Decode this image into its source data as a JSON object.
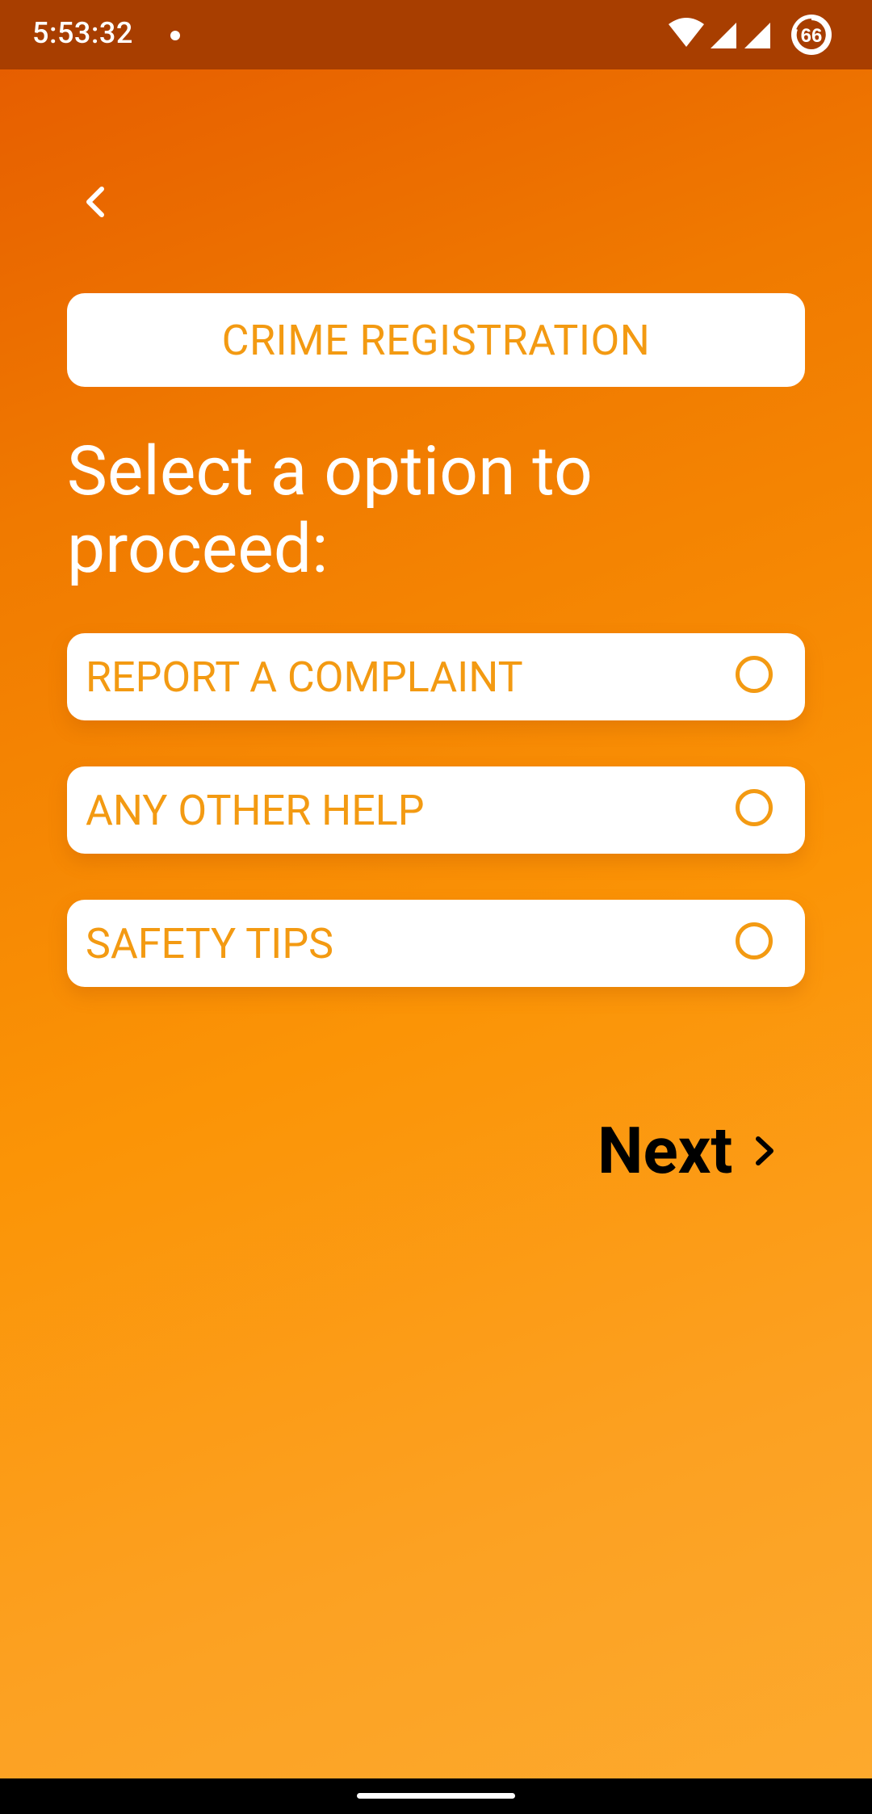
{
  "status_bar": {
    "time": "5:53:32",
    "battery_level": "66"
  },
  "header": {
    "title": "CRIME REGISTRATION"
  },
  "prompt": "Select a option to proceed:",
  "options": [
    {
      "label": "REPORT A COMPLAINT",
      "selected": false
    },
    {
      "label": "ANY OTHER HELP",
      "selected": false
    },
    {
      "label": "SAFETY TIPS",
      "selected": false
    }
  ],
  "next_label": "Next",
  "colors": {
    "accent": "#F39A12",
    "status_bar": "#A83E00",
    "gradient_top": "#E55A00",
    "gradient_bottom": "#FDAA2E"
  }
}
